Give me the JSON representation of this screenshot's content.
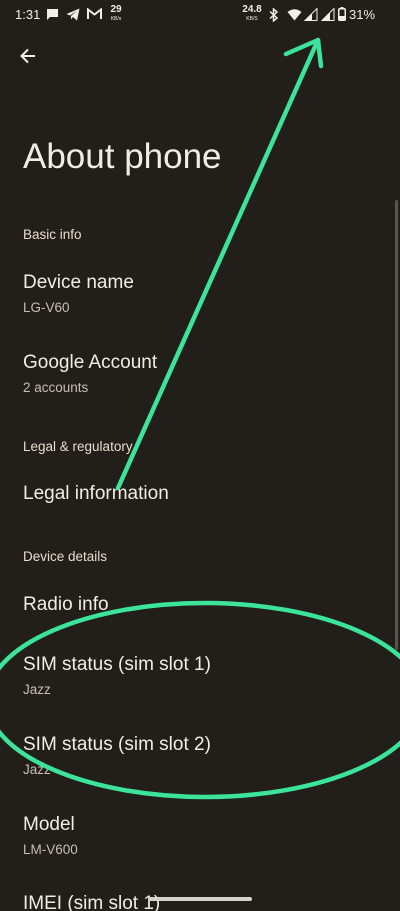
{
  "status_bar": {
    "time": "1:31",
    "speed_left": {
      "value": "29",
      "unit": "KB/s"
    },
    "speed_right": {
      "value": "24.8",
      "unit": "KB/S"
    },
    "battery": "31%",
    "icons": [
      "message-icon",
      "telegram-icon",
      "gmail-icon",
      "bluetooth-icon",
      "wifi-icon",
      "signal-icon",
      "signal-icon",
      "battery-icon"
    ]
  },
  "header": {
    "back_icon": "arrow-back-icon",
    "title": "About phone"
  },
  "sections": {
    "basic_info": "Basic info",
    "legal": "Legal & regulatory",
    "device_details": "Device details"
  },
  "items": {
    "device_name": {
      "title": "Device name",
      "summary": "LG-V60"
    },
    "google_account": {
      "title": "Google Account",
      "summary": "2 accounts"
    },
    "legal_information": {
      "title": "Legal information"
    },
    "radio_info": {
      "title": "Radio info"
    },
    "sim_status_1": {
      "title": "SIM status (sim slot 1)",
      "summary": "Jazz"
    },
    "sim_status_2": {
      "title": "SIM status (sim slot 2)",
      "summary": "Jazz"
    },
    "model": {
      "title": "Model",
      "summary": "LM-V600"
    },
    "imei_1": {
      "title": "IMEI (sim slot 1)"
    }
  },
  "colors": {
    "background": "#221e1a",
    "text": "#f1ece6",
    "annotation": "#3be39b"
  }
}
